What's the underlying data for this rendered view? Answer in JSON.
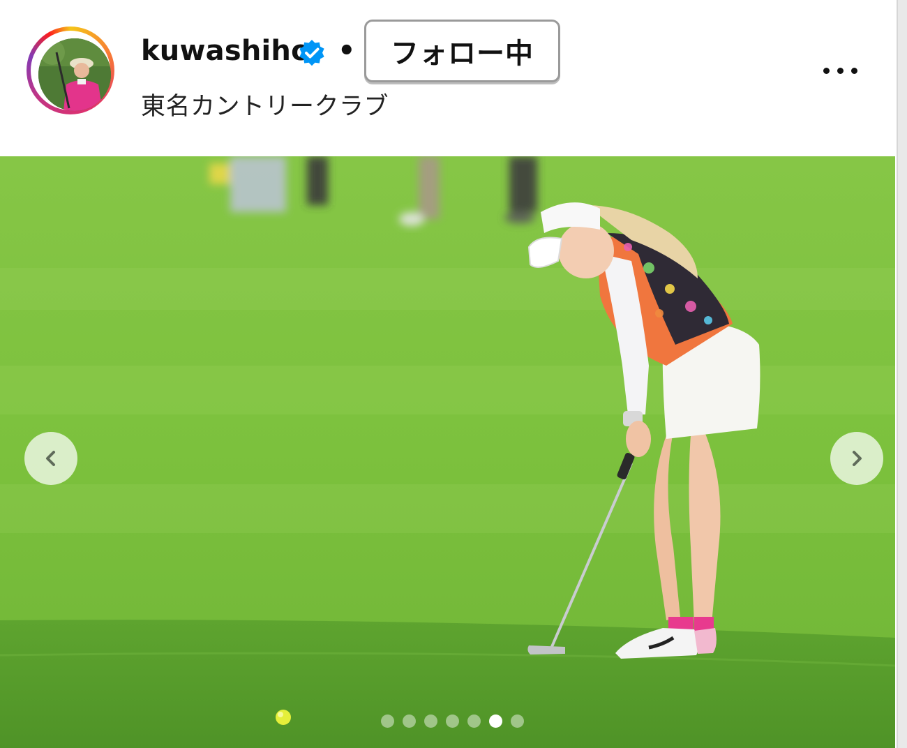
{
  "post": {
    "username": "kuwashiho",
    "verified": true,
    "separator": "•",
    "follow_button_label": "フォロー中",
    "location": "東名カントリークラブ"
  },
  "icons": {
    "verified": "verified-badge-icon",
    "more": "more-options-icon",
    "prev": "chevron-left-icon",
    "next": "chevron-right-icon"
  },
  "carousel": {
    "total_slides": 7,
    "active_index": 5
  },
  "colors": {
    "verified_blue": "#0095f6",
    "story_ring": [
      "#f5c518",
      "#e1306c",
      "#833ab4"
    ],
    "grass": "#79c23a"
  }
}
